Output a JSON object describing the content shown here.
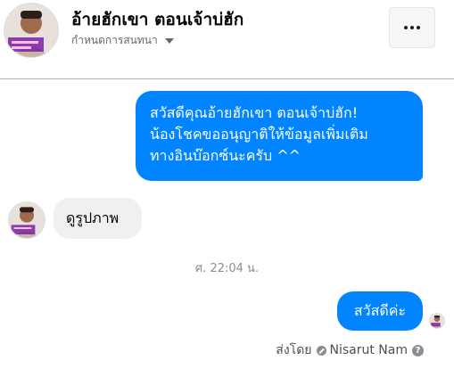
{
  "header": {
    "title": "อ้ายฮักเขา ตอนเจ้าบ่ฮัก",
    "subtitle": "กำหนดการสนทนา",
    "avatar_icon": "profile-avatar",
    "more_icon": "more-dots-icon"
  },
  "messages": {
    "outgoing_1_lines": [
      "สวัสดีคุณอ้ายฮักเขา ตอนเจ้าบ่ฮัก!",
      "น้องโชคขออนุญาติให้ข้อมูลเพิ่มเติม",
      "ทางอินบ๊อกซ์นะครับ ^^"
    ],
    "incoming_1": "ดูรูปภาพ",
    "timestamp": "ศ. 22:04 น.",
    "outgoing_2": "สวัสดีค่ะ"
  },
  "footer": {
    "sent_by_label": "ส่งโดย",
    "sender_name": "Nisarut Nam",
    "help_icon": "?"
  },
  "colors": {
    "accent": "#0084ff",
    "incoming_bubble": "#f1f0f0",
    "muted_text": "#65676b"
  }
}
